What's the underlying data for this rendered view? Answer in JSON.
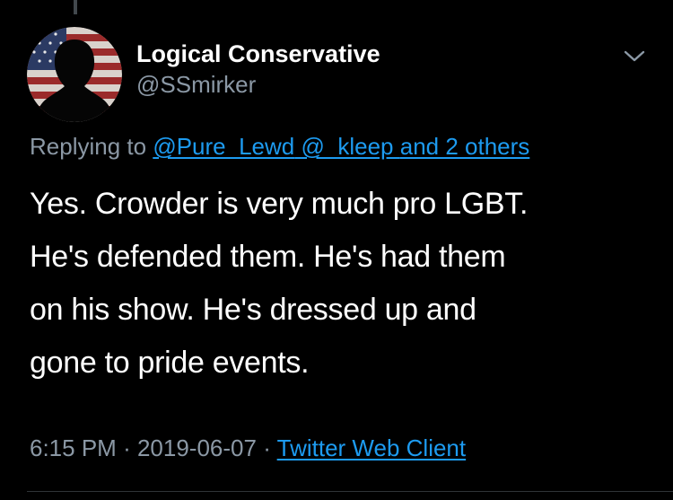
{
  "tweet": {
    "author": {
      "display_name": "Logical Conservative",
      "handle": "@SSmirker",
      "avatar": "flag-silhouette-avatar"
    },
    "menu_icon": "chevron-down-icon",
    "reply": {
      "prefix": "Replying to ",
      "mention_1": "@Pure_Lewd",
      "mention_2": "@_kleep",
      "and_others": "and 2 others"
    },
    "text": "Yes.  Crowder is very much pro LGBT.\nHe's defended them.  He's had them\non his show.  He's dressed up and\ngone to pride events.",
    "time": "6:15 PM",
    "date": "2019-06-07",
    "source": "Twitter Web Client"
  },
  "colors": {
    "background": "#000000",
    "text": "#ffffff",
    "secondary": "#8b98a5",
    "link": "#1d9bf0",
    "divider": "#2f3336"
  }
}
